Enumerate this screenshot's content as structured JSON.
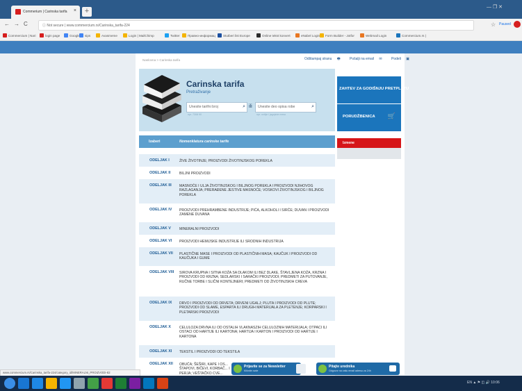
{
  "browser": {
    "tab_title": "Commerium | Carinska tarifa",
    "tab_close": "×",
    "new_tab": "+",
    "back": "←",
    "forward": "→",
    "reload": "C",
    "security": "Not secure",
    "url": "www.commercium.rs/Carinska_tarifa-224",
    "star": "☆",
    "paused": "Paused",
    "window_controls": "—  ❐  ✕",
    "bookmarks": [
      "Commercium | Nari",
      "login page",
      "Google",
      "sips",
      "Avasmeme",
      "Login | MailChimp",
      "Twitter",
      "Правно-информац",
      "Stutberi list Europe",
      "Online tekst konvert",
      "eNabel Login",
      "Form Builder - Jotfor",
      "Webmail Login",
      "Commercium.rs |"
    ]
  },
  "page": {
    "breadcrumb": "Naslovna > Carinska tarifa",
    "top_links": [
      "Odštampaj stranu",
      "Pošalji na email",
      "Podeli"
    ],
    "title": "Carinska tarifa",
    "subtitle": "Pretraživanje",
    "search1_placeholder": "Unesite tarifni broj",
    "search1_hint": "npr. 7308 90",
    "search2_placeholder": "Unesite deo opisa robe",
    "search2_hint": "npr. ovčije i jagnjeće meso",
    "sep": "ili",
    "btn_subscription": "ZAHTEV ZA GODIŠNJU PRETPLATU",
    "btn_order": "PORUDŽBENICA",
    "th_izaberi": "Izaberi",
    "th_nomenklatura": "Nomenklatura carinske tarife",
    "side_header": "Izmene",
    "rows": [
      {
        "code": "ODELJAK I",
        "desc": "ŽIVE ŽIVOTINJE; PROIZVODI ŽIVOTINJSKOG POREKLA"
      },
      {
        "code": "ODELJAK II",
        "desc": "BILJNI PROIZVODI"
      },
      {
        "code": "ODELJAK III",
        "desc": "MASNOĆE I ULJA ŽIVOTINJSKOG I BILJNOG POREKLA I PROIZVODI NJIHOVOG RAZLAGANJA; PRERAĐENE JESTIVE MASNOĆE; VOSKOVI ŽIVOTINJSKOG I BILJNOG POREKLA"
      },
      {
        "code": "ODELJAK IV",
        "desc": "PROIZVODI PREHRAMBENE INDUSTRIJE; PIĆA, ALKOHOLI I SIRĆE; DUVAN I PROIZVODI ZAMENE DUVANA"
      },
      {
        "code": "ODELJAK V",
        "desc": "MINERALNI PROIZVODI"
      },
      {
        "code": "ODELJAK VI",
        "desc": "PROIZVODI HEMIJSKE INDUSTRIJE ILI SRODNIH INDUSTRIJA"
      },
      {
        "code": "ODELJAK VII",
        "desc": "PLASTIČNE MASE I PROIZVODI OD PLASTIČNIH MASA; KAUČUK I PROIZVODI OD KAUČUKA I GUME"
      },
      {
        "code": "ODELJAK VIII",
        "desc": "SIROVA KRUPNA I SITNA KOŽA SA DLAKOM ILI BEZ DLAKE, ŠTAVLJENA KOŽA, KRZNA I PROIZVODI OD KRZNA; SEDLARSKI I SARAČKI PROIZVODI; PREDMETI ZA PUTOVANJE, RUČNE TORBE I SLIČNI KONTEJNERI; PREDMETI OD ŽIVOTINJSKIH CREVA"
      },
      {
        "code": "ODELJAK IX",
        "desc": "DRVO I PROIZVODI OD DRVETA; DRVENI UGALJ; PLUTA I PROIZVODI OD PLUTE; PROIZVODI OD SLAME, ESPARTA ILI DRUGIH MATERIJALA ZA PLETENJE; KORPARSKI I PLETARSKI PROIZVODI"
      },
      {
        "code": "ODELJAK X",
        "desc": "CELULOZA DRVNA ILI OD OSTALIH VLAKNASZIH CELULOZNIH MATERIJALA; OTPACI ILI OSTACI OD HARTIJE ILI KARTONA; HARTIJA I KARTON I PROIZVODI OD HARTIJE I KARTONA"
      },
      {
        "code": "ODELJAK XI",
        "desc": "TEKSTIL I PROIZVODI OD TEKSTILA"
      },
      {
        "code": "ODELJAK XII",
        "desc": "OBUĆA; ŠEŠIRI, KAPE I OS... ŠTAPOVI, BIČEVI, KORBAČ... I PERJA; VEŠTAČKO CVE..."
      }
    ],
    "status_url": "www.commercium.rs/Carinska_tarifa-224/category_id/MINERALNI_PROIZVODI-82",
    "newsletter_title": "Prijavite se za Newsletter",
    "newsletter_sub": "Kliknite ovde",
    "editor_title": "Pitajte urednika",
    "editor_sub": "Odgovor na vašu email adresu za 24h"
  },
  "taskbar": {
    "tray": "EN  ▲  ⚑  ◫  🔊   10:06"
  },
  "colors": {
    "accent": "#1b75bc",
    "header": "#5c9fce",
    "red": "#d61518",
    "row_alt": "#e3eef7"
  }
}
